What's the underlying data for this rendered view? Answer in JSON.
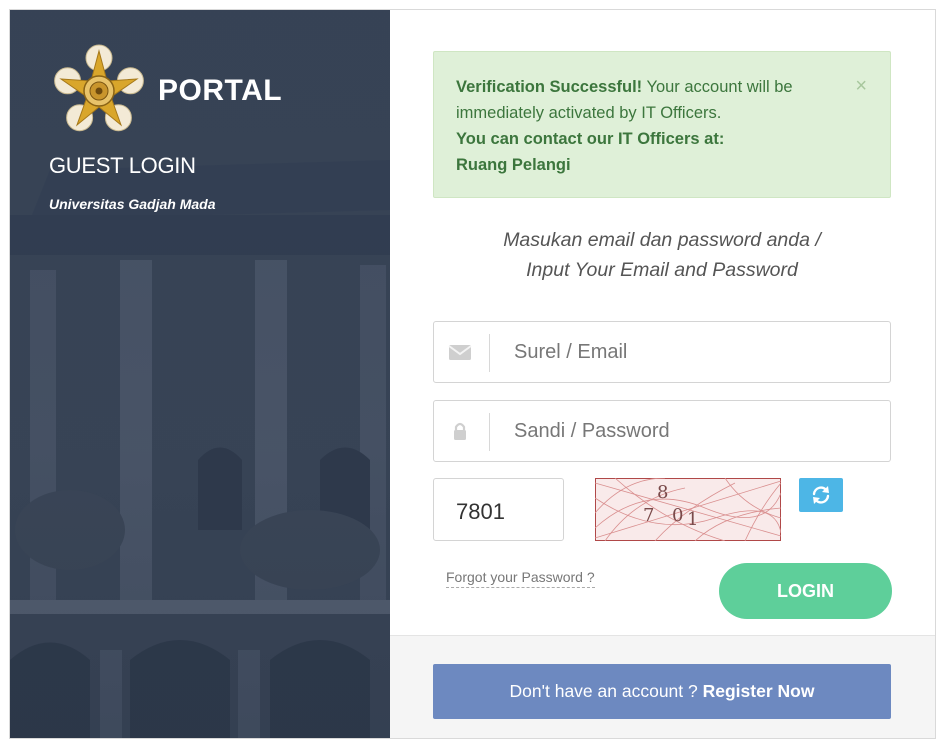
{
  "left_panel": {
    "portal_title": "PORTAL",
    "guest_login": "GUEST LOGIN",
    "university": "Universitas Gadjah Mada"
  },
  "alert": {
    "heading": "Verification Successful!",
    "message": "Your account will be immediately activated by IT Officers.",
    "contact_label": "You can contact our IT Officers at:",
    "contact_location": "Ruang Pelangi",
    "close_symbol": "×"
  },
  "form": {
    "instructions_line1": "Masukan email dan password anda /",
    "instructions_line2": "Input Your Email and Password",
    "email_placeholder": "Surel / Email",
    "password_placeholder": "Sandi / Password",
    "captcha_value": "7801",
    "forgot_password": "Forgot your Password ?",
    "login_label": "LOGIN"
  },
  "footer": {
    "register_prefix": "Don't have an account ?",
    "register_link": "Register Now"
  },
  "colors": {
    "alert_bg": "#dff0d8",
    "alert_text": "#3c763d",
    "login_button": "#5ecf9a",
    "register_button": "#6d89c0",
    "refresh_button": "#4db6e6"
  },
  "icons": [
    "envelope-icon",
    "lock-icon",
    "refresh-icon",
    "close-icon",
    "ugm-logo"
  ]
}
